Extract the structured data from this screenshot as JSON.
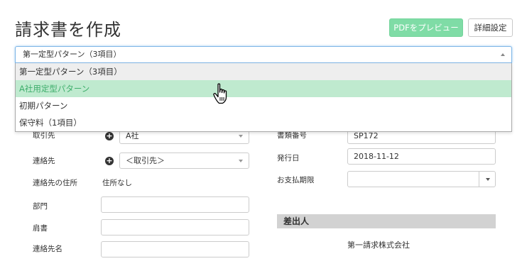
{
  "header": {
    "title": "請求書を作成",
    "preview_button": "PDFをプレビュー",
    "settings_button": "詳細設定"
  },
  "template_select": {
    "value": "第一定型パターン（3項目）",
    "options": [
      "第一定型パターン（3項目）",
      "A社用定型パターン",
      "初期パターン",
      "保守料（1項目）"
    ],
    "selected_index": 0,
    "hover_index": 1
  },
  "left_form": {
    "client_label": "取引先",
    "client_value": "A社",
    "contact_label": "連絡先",
    "contact_value": "＜取引先＞",
    "contact_address_label": "連絡先の住所",
    "contact_address_value": "住所なし",
    "department_label": "部門",
    "department_value": "",
    "title_label": "肩書",
    "title_value": "",
    "contact_name_label": "連絡先名",
    "contact_name_value": ""
  },
  "right_form": {
    "doc_number_label": "書類番号",
    "doc_number_value": "SP172",
    "issue_date_label": "発行日",
    "issue_date_value": "2018-11-12",
    "due_date_label": "お支払期限",
    "due_date_value": "",
    "sender_section": "差出人",
    "sender_company": "第一請求株式会社"
  },
  "colors": {
    "accent": "#7fdca6",
    "hover_bg": "#bfeacf",
    "hover_text": "#3fae6c",
    "focus_border": "#7db5e6"
  }
}
